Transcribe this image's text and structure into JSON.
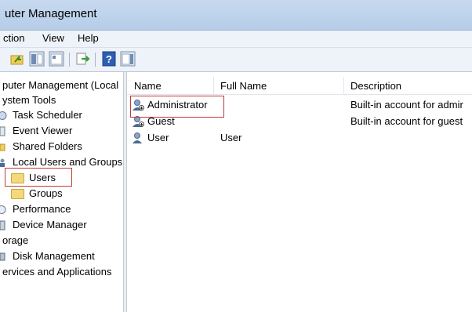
{
  "window": {
    "title": "uter Management"
  },
  "menu": {
    "items": [
      "ction",
      "View",
      "Help"
    ]
  },
  "toolbar": {
    "icons": [
      "up-folder-icon",
      "show-hide-tree-icon",
      "export-list-icon",
      "help-icon",
      "show-action-pane-icon"
    ]
  },
  "tree": {
    "items": [
      {
        "label": "puter Management (Local",
        "icon": "computer-icon"
      },
      {
        "label": "ystem Tools",
        "icon": "tools-icon"
      },
      {
        "label": "Task Scheduler",
        "icon": "clock-icon"
      },
      {
        "label": "Event Viewer",
        "icon": "event-viewer-icon"
      },
      {
        "label": "Shared Folders",
        "icon": "shared-folder-icon"
      },
      {
        "label": "Local Users and Groups",
        "icon": "users-groups-icon"
      },
      {
        "label": "Users",
        "icon": "folder-icon",
        "selected": true
      },
      {
        "label": "Groups",
        "icon": "folder-icon"
      },
      {
        "label": "Performance",
        "icon": "performance-icon"
      },
      {
        "label": "Device Manager",
        "icon": "device-manager-icon"
      },
      {
        "label": "orage",
        "icon": "storage-icon"
      },
      {
        "label": "Disk Management",
        "icon": "disk-icon"
      },
      {
        "label": "ervices and Applications",
        "icon": "services-icon"
      }
    ]
  },
  "list": {
    "columns": [
      "Name",
      "Full Name",
      "Description"
    ],
    "rows": [
      {
        "name": "Administrator",
        "full_name": "",
        "description": "Built-in account for admir",
        "icon": "user-account-icon",
        "highlighted": true
      },
      {
        "name": "Guest",
        "full_name": "",
        "description": "Built-in account for guest",
        "icon": "user-account-icon"
      },
      {
        "name": "User",
        "full_name": "User",
        "description": "",
        "icon": "user-account-icon"
      }
    ]
  },
  "colors": {
    "highlight": "#c4393a",
    "titlebar": "#c7d9ef"
  }
}
